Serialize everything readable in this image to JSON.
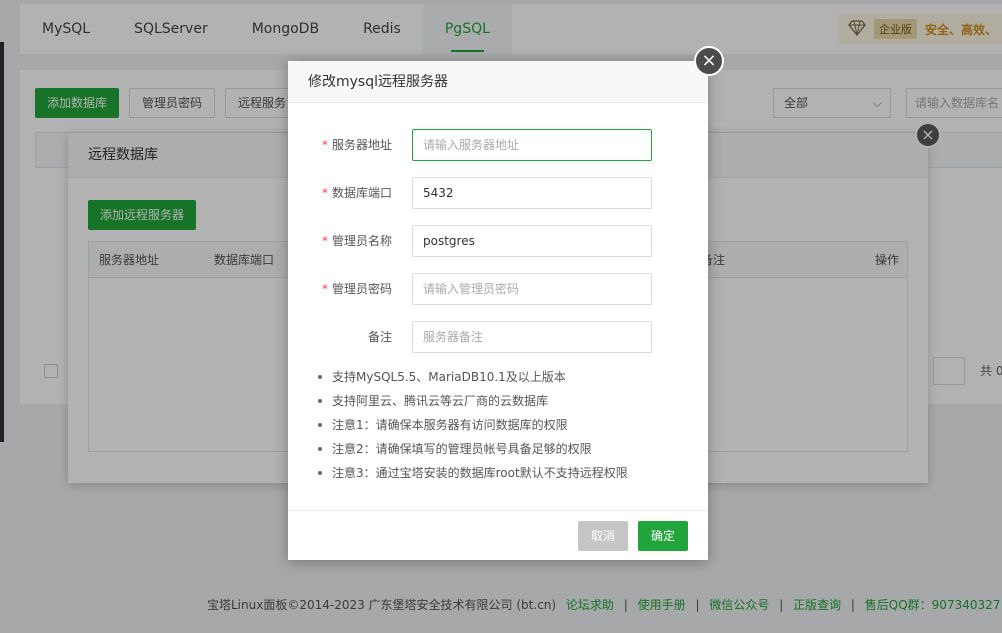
{
  "tabs": [
    {
      "label": "MySQL"
    },
    {
      "label": "SQLServer"
    },
    {
      "label": "MongoDB"
    },
    {
      "label": "Redis"
    },
    {
      "label": "PgSQL",
      "active": true
    }
  ],
  "enterprise": {
    "badge": "企业版",
    "text": "安全、高效、"
  },
  "toolbar": {
    "add_db": "添加数据库",
    "admin_pwd": "管理员密码",
    "remote": "远程服务"
  },
  "filter": {
    "select_value": "全部",
    "search_placeholder": "请输入数据库名"
  },
  "pager": {
    "total_prefix": "共 0"
  },
  "remote_layer": {
    "title": "远程数据库",
    "add_button": "添加远程服务器",
    "columns": {
      "server_addr": "服务器地址",
      "db_port": "数据库端口",
      "remark": "备注",
      "action": "操作"
    }
  },
  "modal": {
    "title": "修改mysql远程服务器",
    "fields": [
      {
        "label": "服务器地址",
        "required": true,
        "value": "",
        "placeholder": "请输入服务器地址"
      },
      {
        "label": "数据库端口",
        "required": true,
        "value": "5432",
        "placeholder": ""
      },
      {
        "label": "管理员名称",
        "required": true,
        "value": "postgres",
        "placeholder": ""
      },
      {
        "label": "管理员密码",
        "required": true,
        "value": "",
        "placeholder": "请输入管理员密码"
      },
      {
        "label": "备注",
        "required": false,
        "value": "",
        "placeholder": "服务器备注"
      }
    ],
    "notes": [
      "支持MySQL5.5、MariaDB10.1及以上版本",
      "支持阿里云、腾讯云等云厂商的云数据库",
      "注意1：请确保本服务器有访问数据库的权限",
      "注意2：请确保填写的管理员帐号具备足够的权限",
      "注意3：通过宝塔安装的数据库root默认不支持远程权限"
    ],
    "cancel_label": "取消",
    "ok_label": "确定"
  },
  "footer": {
    "copyright": "宝塔Linux面板©2014-2023 广东堡塔安全技术有限公司 (bt.cn)",
    "links": [
      "论坛求助",
      "使用手册",
      "微信公众号",
      "正版查询"
    ],
    "qq": "售后QQ群：907340327"
  },
  "colors": {
    "accent": "#20a53a",
    "required": "#e34b4b"
  }
}
